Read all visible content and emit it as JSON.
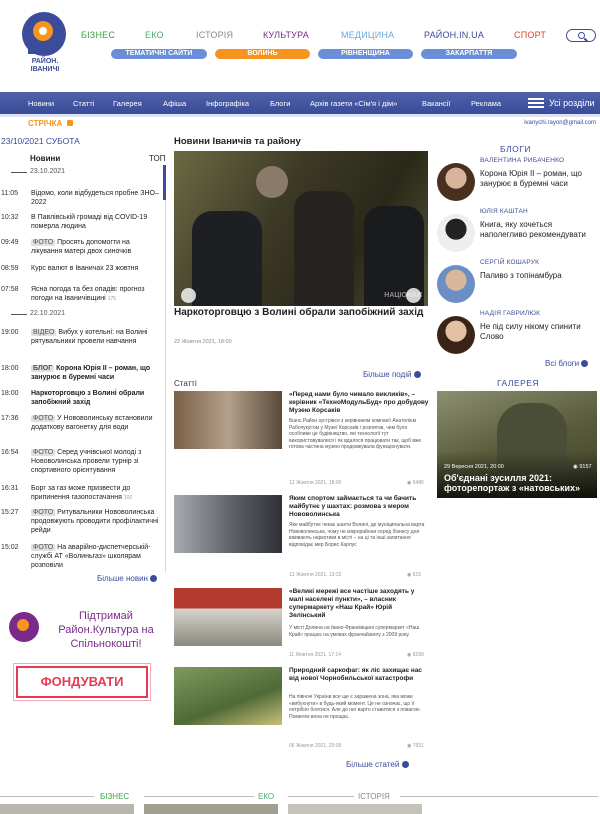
{
  "logo": {
    "text": "РАЙОН. ІВАНИЧІ"
  },
  "topnav": [
    {
      "label": "БІЗНЕС",
      "color": "#3aa24a"
    },
    {
      "label": "ЕКО",
      "color": "#4cae6a"
    },
    {
      "label": "ІСТОРІЯ",
      "color": "#8a8a8a"
    },
    {
      "label": "КУЛЬТУРА",
      "color": "#7a2b8a"
    },
    {
      "label": "МЕДИЦИНА",
      "color": "#6aa7d9"
    },
    {
      "label": "РАЙОН.IN.UA",
      "color": "#3a4c9a"
    },
    {
      "label": "СПОРТ",
      "color": "#e0422c"
    }
  ],
  "pills": [
    {
      "label": "ТЕМАТИЧНІ САЙТИ",
      "color": "#6a8fd6"
    },
    {
      "label": "ВОЛИНЬ",
      "color": "#f7941d"
    },
    {
      "label": "РІВНЕНЩИНА",
      "color": "#6a8fd6"
    },
    {
      "label": "ЗАКАРПАТТЯ",
      "color": "#6a8fd6"
    }
  ],
  "mainnav": [
    "Новини",
    "Статті",
    "Галерея",
    "Афіша",
    "Інфографіка",
    "Блоги",
    "Архів газети «Сім'я і дім»",
    "Вакансії",
    "Реклама"
  ],
  "allsections": "Усі розділи",
  "strichka": "СТРІЧКА",
  "email": "ivanychi.rayon@gmail.com",
  "date": "23/10/2021  СУБОТА",
  "feed": {
    "tab_news": "Новини",
    "tab_top": "ТОП",
    "sep1": "23.10.2021",
    "sep2": "22.10.2021",
    "items": [
      {
        "time": "11:05",
        "tag": "",
        "text": "Відомо, коли відбудеться пробне ЗНО–2022",
        "bold": false,
        "count": ""
      },
      {
        "time": "10:32",
        "tag": "",
        "text": "В Павлівській громаді від COVID-19 померла людина",
        "bold": false,
        "count": ""
      },
      {
        "time": "09:49",
        "tag": "ФОТО",
        "text": "Просять допомогти на лікування матері двох синочків",
        "bold": false,
        "count": ""
      },
      {
        "time": "08:59",
        "tag": "",
        "text": "Курс валют в Іваничах 23 жовтня",
        "bold": false,
        "count": ""
      },
      {
        "time": "07:58",
        "tag": "",
        "text": "Ясна погода та без опадів: прогноз погоди на Іваничівщині",
        "bold": false,
        "count": "175"
      },
      {
        "time": "19:00",
        "tag": "ВІДЕО",
        "text": "Вибух у котельні: на Волині рятувальники провели навчання",
        "bold": false,
        "count": ""
      },
      {
        "time": "18:00",
        "tag": "БЛОГ",
        "text": "Корона Юрія ІІ – роман, що занурює в буремні часи",
        "bold": true,
        "count": ""
      },
      {
        "time": "18:00",
        "tag": "",
        "text": "Наркоторговцю з Волині обрали запобіжний захід",
        "bold": true,
        "count": ""
      },
      {
        "time": "17:36",
        "tag": "ФОТО",
        "text": "У Нововолинську встановили додаткову вагонетку для води",
        "bold": false,
        "count": ""
      },
      {
        "time": "16:54",
        "tag": "ФОТО",
        "text": "Серед учнівської молоді з Нововолинська провели турнір зі спортивного орієнтування",
        "bold": false,
        "count": ""
      },
      {
        "time": "16:31",
        "tag": "",
        "text": "Борг за газ може призвести до припинення газопостачання",
        "bold": false,
        "count": "102"
      },
      {
        "time": "15:27",
        "tag": "ФОТО",
        "text": "Ритувальники Нововолинська продовжують проводити профілактичні рейди",
        "bold": false,
        "count": ""
      },
      {
        "time": "15:02",
        "tag": "ФОТО",
        "text": "На аварійно-диспетчерській-службі АТ «Волиньгаз» школярам розповіли",
        "bold": false,
        "count": ""
      }
    ],
    "more": "Більше новин"
  },
  "promo": {
    "text": "Підтримай Район.Культура на Спільнокошті!",
    "button": "ФОНДУВАТИ"
  },
  "center": {
    "heading": "Новини Іваничів та району",
    "hero_title": "Наркоторговцю з Волині обрали запобіжний захід",
    "hero_date": "22 Жовтня 2021, 18:00",
    "hero_watermark": "НАЦІОНАЛ",
    "more_news": "Більше подій",
    "articles_label": "Статті",
    "articles": [
      {
        "title": "«Перед нами було чимало викликів», – керівник «ТехноМодульБуд» про добудову Музею Корсаків",
        "desc": "Біанс.Район зустрівся з керівником компанії Анатолієм Рабочукусом у Музеї Корсаків і розпитав, чим було особливе це будівництво, які технології тут використовувалися і як вдалося працювати так, щоб вже готова частина музею продовжувала функціонувати.",
        "date": "13 Жовтня 2021, 18:00",
        "views": "5486"
      },
      {
        "title": "Яким спортом займається та чи бачить майбутнє у шахтах: розмова з мером Нововолинська",
        "desc": "Яке майбутнє чекає шахти Волині, де муніципальна варта Нововолинська, чому не мікрорайони серед бізнесу дня вживають наркотики в місті – на ці та інші запитання відповідає мер Борис Карпус",
        "date": "13 Жовтня 2021, 13:32",
        "views": "615"
      },
      {
        "title": "«Великі мережі все частіше заходять у малі населені пункти», – власник супермаркету «Наш Край» Юрій Зелінський",
        "desc": "У місті Долина на Івано-Франківщині супермаркет «Наш Край» працює на умовах франчайзингу з 2009 року.",
        "date": "11 Жовтня 2021, 17:14",
        "views": "8299"
      },
      {
        "title": "Природний саркофаг: як ліс захищає нас від нової Чорнобильської катастрофи",
        "desc": "На півночі України все ще є заражена зона, яка може «вибухнути» в будь-який момент. Це не означає, що її потрібно боятися. Але до неї варто ставитися з повагою. Помилок вона не прощає.",
        "date": "06 Жовтня 2021, 20:05",
        "views": "7651"
      }
    ],
    "more_articles": "Більше статей"
  },
  "blogs": {
    "heading": "БЛОГИ",
    "items": [
      {
        "author": "ВАЛЕНТИНА РИБАЧЕНКО",
        "title": "Корона Юрія ІІ – роман, що занурює в буремні часи"
      },
      {
        "author": "ЮЛІЯ КАШТАН",
        "title": "Книга, яку хочеться наполегливо рекомендувати"
      },
      {
        "author": "СЕРГІЙ КОШАРУК",
        "title": "Паливо з топінамбура"
      },
      {
        "author": "НАДІЯ ГАВРИЛЮК",
        "title": "Не під силу нікому спинити Слово"
      }
    ],
    "all": "Всі блоги"
  },
  "gallery": {
    "heading": "ГАЛЕРЕЯ",
    "date": "29 Вересня 2021, 20:00",
    "count": "9157",
    "title": "Об'єднані зусилля 2021: фоторепортаж з «натовських»"
  },
  "bottom": [
    {
      "label": "БІЗНЕС",
      "color": "#3aa24a"
    },
    {
      "label": "ЕКО",
      "color": "#4cae6a"
    },
    {
      "label": "ІСТОРІЯ",
      "color": "#8a8a8a"
    }
  ]
}
